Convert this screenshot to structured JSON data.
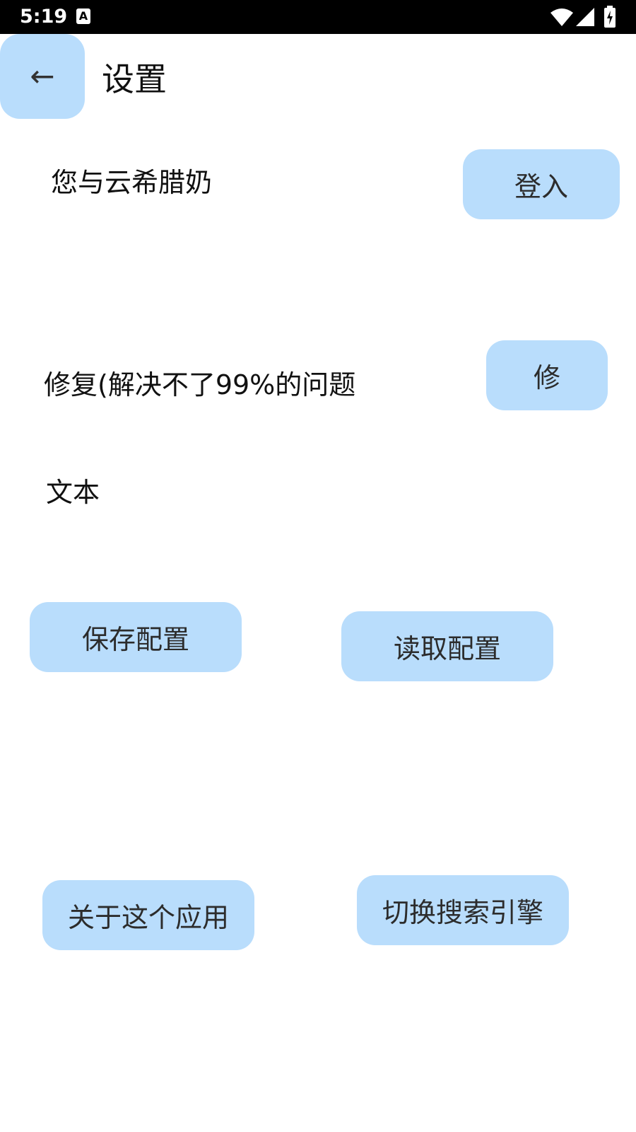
{
  "status_bar": {
    "time": "5:19",
    "notification_glyph": "A",
    "icons": [
      "wifi-icon",
      "signal-icon",
      "battery-charging-icon"
    ],
    "background_color": "#000000",
    "text_color": "#ffffff"
  },
  "header": {
    "back_glyph": "←",
    "back_icon": "back-arrow-icon",
    "title": "设置"
  },
  "account": {
    "label": "您与云希腊奶",
    "button_label": "登入"
  },
  "repair": {
    "label": "修复(解决不了99%的问题",
    "button_label": "修"
  },
  "text_label": "文本",
  "config": {
    "save_label": "保存配置",
    "load_label": "读取配置"
  },
  "misc": {
    "about_label": "关于这个应用",
    "switch_engine_label": "切换搜索引擎"
  },
  "colors": {
    "button_background": "#b9ddfc",
    "button_text": "#2c2c2c",
    "page_background": "#ffffff",
    "text": "#111111"
  }
}
